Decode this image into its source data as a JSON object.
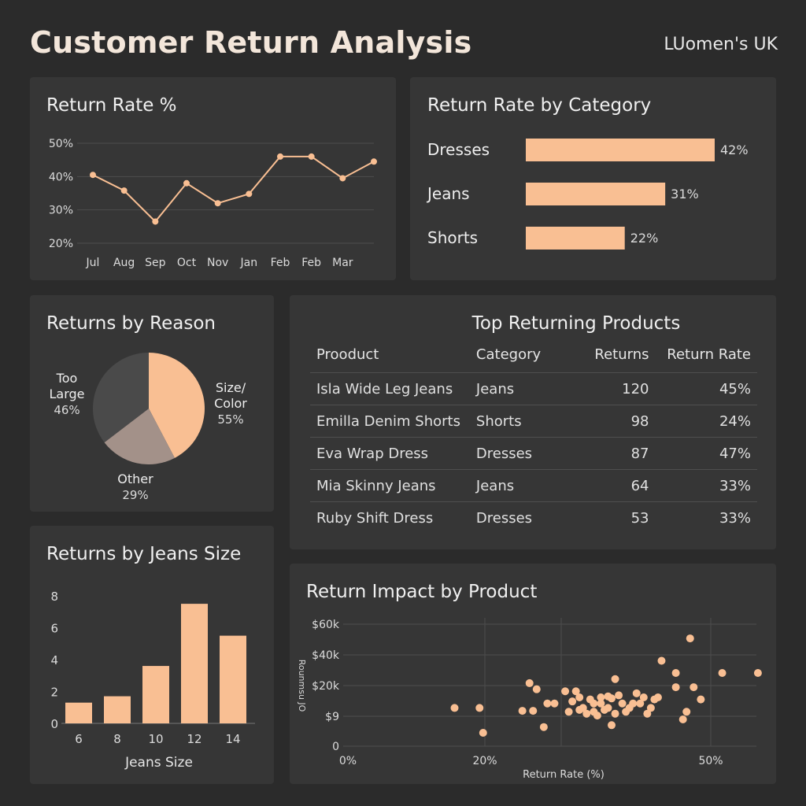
{
  "header": {
    "title": "Customer Return Analysis",
    "brand": "LUomen's UK"
  },
  "colors": {
    "accent": "#f9bf93",
    "panel": "#363636",
    "background": "#2b2b2b",
    "grid": "#4d4d4d",
    "pie_dark": "#4a4a4a",
    "pie_mid": "#a39189"
  },
  "panels": {
    "return_rate": {
      "title": "Return Rate %"
    },
    "category": {
      "title": "Return Rate by Category"
    },
    "reason": {
      "title": "Returns by Reason"
    },
    "products": {
      "title": "Top Returning Products"
    },
    "jeans_size": {
      "title": "Returns by Jeans Size"
    },
    "impact": {
      "title": "Return Impact by Product"
    }
  },
  "table": {
    "headers": [
      "Prooduct",
      "Category",
      "Returns",
      "Return Rate"
    ],
    "rows": [
      [
        "Isla Wide Leg Jeans",
        "Jeans",
        "120",
        "45%"
      ],
      [
        "Emilla Denim Shorts",
        "Shorts",
        "98",
        "24%"
      ],
      [
        "Eva Wrap Dress",
        "Dresses",
        "87",
        "47%"
      ],
      [
        "Mia Skinny Jeans",
        "Jeans",
        "64",
        "33%"
      ],
      [
        "Ruby Shift Dress",
        "Dresses",
        "53",
        "33%"
      ]
    ]
  },
  "chart_data": [
    {
      "type": "line",
      "title": "Return Rate %",
      "categories": [
        "Jul",
        "Aug",
        "Sep",
        "Oct",
        "Nov",
        "Jan",
        "Feb",
        "Feb",
        "Mar"
      ],
      "extra_point": 44.5,
      "values": [
        40.5,
        35.8,
        26.5,
        38,
        32,
        34.8,
        46,
        46,
        39.5
      ],
      "ylim": [
        20,
        50
      ],
      "yticks": [
        "20%",
        "30%",
        "40%",
        "50%"
      ],
      "grid": true
    },
    {
      "type": "bar",
      "title": "Return Rate by Category",
      "orientation": "horizontal",
      "categories": [
        "Dresses",
        "Jeans",
        "Shorts"
      ],
      "values": [
        42,
        31,
        22
      ],
      "labels": [
        "42%",
        "31%",
        "22%"
      ]
    },
    {
      "type": "pie",
      "title": "Returns by Reason",
      "slices": [
        {
          "label_lines": [
            "Size/",
            "Color"
          ],
          "pct_label": "55%",
          "value": 55
        },
        {
          "label_lines": [
            "Other"
          ],
          "pct_label": "29%",
          "value": 29
        },
        {
          "label_lines": [
            "Too",
            "Large"
          ],
          "pct_label": "46%",
          "value": 46
        }
      ]
    },
    {
      "type": "bar",
      "title": "Returns by Jeans Size",
      "categories": [
        "6",
        "8",
        "10",
        "12",
        "14"
      ],
      "values": [
        1.3,
        1.7,
        3.6,
        7.5,
        5.5
      ],
      "xlabel": "Jeans Size",
      "ylim": [
        0,
        8
      ],
      "yticks": [
        "0",
        "2",
        "4",
        "6",
        "8"
      ]
    },
    {
      "type": "scatter",
      "title": "Return Impact by Product",
      "xlabel": "Return Rate (%)",
      "ylabel": "Rounmsu JO",
      "xticks": [
        "0%",
        "20%",
        "50%"
      ],
      "yticks": [
        "0",
        "$9",
        "$20k",
        "$40k",
        "$60k"
      ],
      "xlim": [
        0,
        55
      ],
      "ylim": [
        0,
        60
      ],
      "points": [
        [
          13.5,
          20
        ],
        [
          17,
          20
        ],
        [
          17.5,
          7
        ],
        [
          23,
          18.5
        ],
        [
          24,
          31
        ],
        [
          24.5,
          18.5
        ],
        [
          25,
          28
        ],
        [
          26,
          10
        ],
        [
          26.5,
          21
        ],
        [
          27.5,
          21
        ],
        [
          29,
          27
        ],
        [
          29.5,
          18
        ],
        [
          30,
          22
        ],
        [
          30.5,
          27
        ],
        [
          31,
          24
        ],
        [
          31,
          19
        ],
        [
          31.5,
          20
        ],
        [
          32,
          17
        ],
        [
          32.5,
          23
        ],
        [
          33,
          21
        ],
        [
          33,
          18
        ],
        [
          33.5,
          16
        ],
        [
          34,
          24
        ],
        [
          34,
          21
        ],
        [
          34.5,
          19
        ],
        [
          35,
          24.5
        ],
        [
          35,
          20
        ],
        [
          35.5,
          23.5
        ],
        [
          35.5,
          11
        ],
        [
          36,
          33
        ],
        [
          36,
          17
        ],
        [
          36.5,
          25
        ],
        [
          37,
          21
        ],
        [
          37.5,
          18
        ],
        [
          38,
          20
        ],
        [
          38.5,
          21
        ],
        [
          39,
          26
        ],
        [
          39.5,
          21
        ],
        [
          40,
          24
        ],
        [
          40.5,
          17
        ],
        [
          41,
          20
        ],
        [
          41.5,
          23
        ],
        [
          42,
          24
        ],
        [
          42.5,
          42
        ],
        [
          44.5,
          29
        ],
        [
          44.5,
          36
        ],
        [
          45.5,
          14
        ],
        [
          46,
          18
        ],
        [
          46.5,
          53
        ],
        [
          47,
          29
        ],
        [
          48,
          23
        ],
        [
          51,
          36
        ],
        [
          56,
          36
        ]
      ]
    }
  ]
}
